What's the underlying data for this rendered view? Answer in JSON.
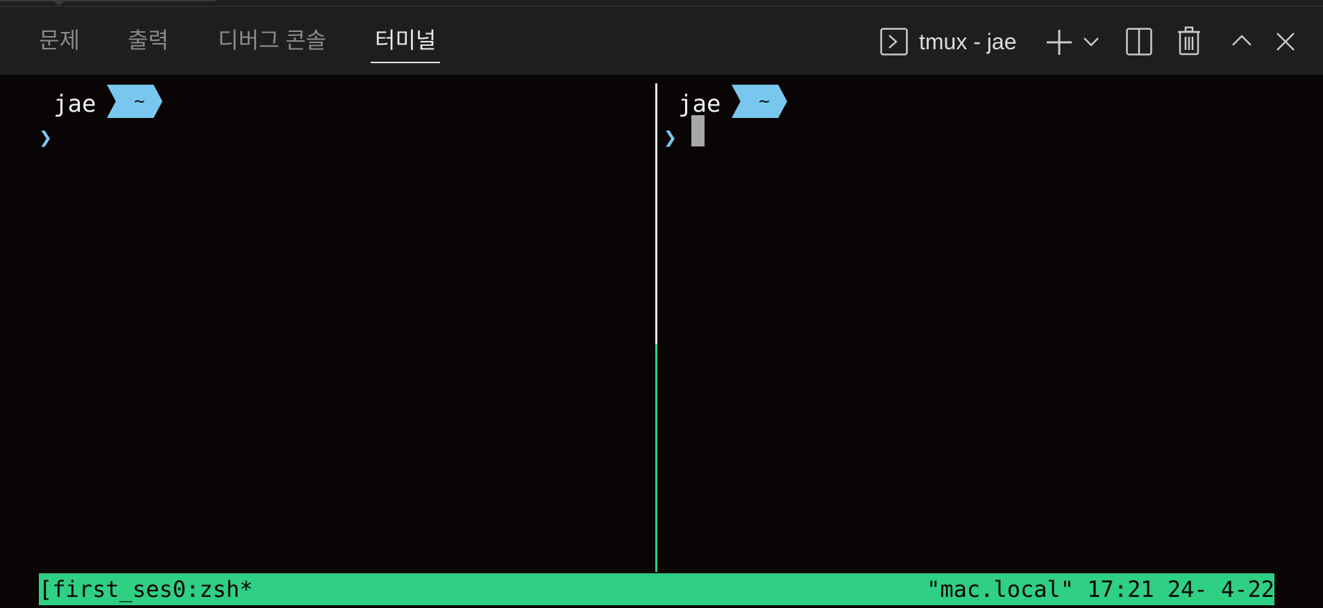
{
  "panel": {
    "tabs": [
      {
        "label": "문제",
        "active": false
      },
      {
        "label": "출력",
        "active": false
      },
      {
        "label": "디버그 콘솔",
        "active": false
      },
      {
        "label": "터미널",
        "active": true
      }
    ],
    "terminal_title": "tmux - jae",
    "icons": [
      "terminal-icon",
      "plus-icon",
      "chevron-down-icon",
      "split-icon",
      "trash-icon",
      "chevron-up-icon",
      "close-icon"
    ]
  },
  "panes": [
    {
      "user": "jae",
      "dir": "~",
      "prompt_char": "❯",
      "active": false
    },
    {
      "user": "jae",
      "dir": "~",
      "prompt_char": "❯",
      "active": true
    }
  ],
  "status": {
    "left": "[first_ses0:zsh*",
    "right": "\"mac.local\" 17:21 24- 4-22"
  },
  "colors": {
    "accent_green": "#2fcf84",
    "prompt_blue": "#79c7ee",
    "background": "#0a0505",
    "panel_bg": "#1e1e1e"
  }
}
